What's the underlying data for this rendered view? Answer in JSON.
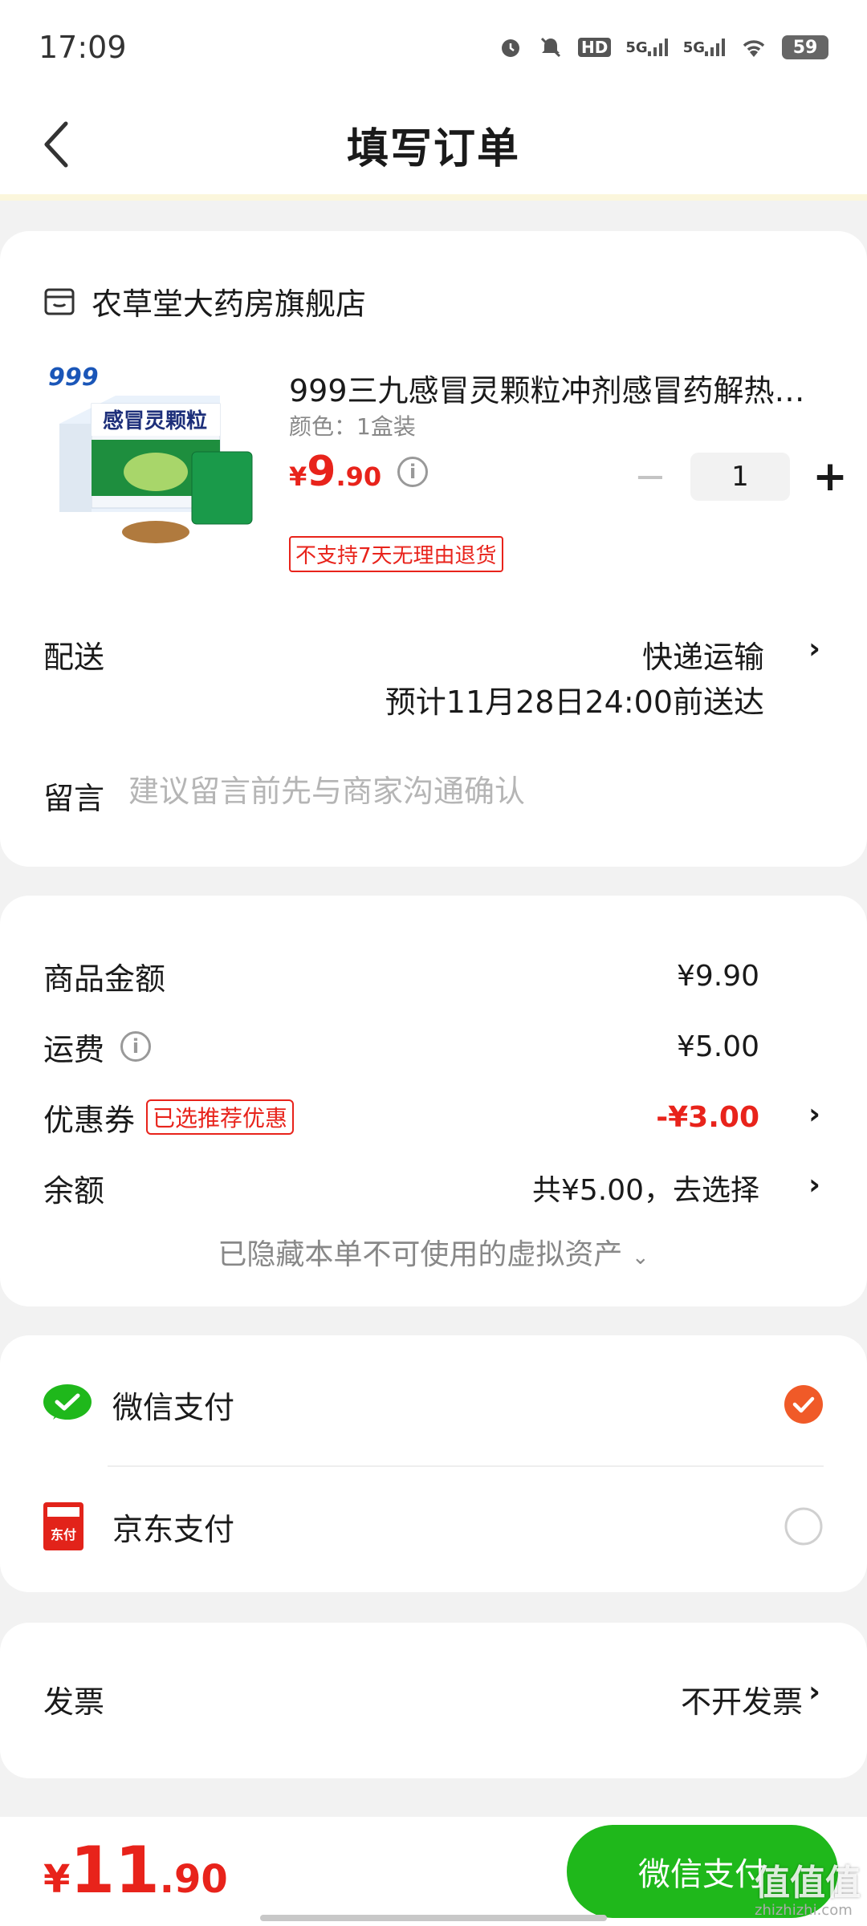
{
  "status_bar": {
    "time": "17:09",
    "icons": [
      "alarm-icon",
      "mute-icon",
      "hd-icon",
      "signal-5g-icon",
      "signal-5g-icon",
      "wifi-icon"
    ],
    "battery": "59",
    "hd_label": "HD",
    "net_label": "5G"
  },
  "header": {
    "title": "填写订单"
  },
  "store": {
    "name": "农草堂大药房旗舰店"
  },
  "product": {
    "title": "999三九感冒灵颗粒冲剂感冒药解热…",
    "spec": "颜色：1盒装",
    "price_symbol": "¥",
    "price_int": "9",
    "price_dec": ".90",
    "quantity": "1",
    "return_tag": "不支持7天无理由退货",
    "box_brand": "999",
    "box_name": "感冒灵颗粒"
  },
  "delivery": {
    "label": "配送",
    "method": "快递运输",
    "estimate": "预计11月28日24:00前送达"
  },
  "message": {
    "label": "留言",
    "placeholder": "建议留言前先与商家沟通确认"
  },
  "amounts": {
    "goods_label": "商品金额",
    "goods_value": "¥9.90",
    "shipping_label": "运费",
    "shipping_value": "¥5.00",
    "coupon_label": "优惠券",
    "coupon_tag": "已选推荐优惠",
    "coupon_value": "-¥3.00",
    "balance_label": "余额",
    "balance_value": "共¥5.00，去选择",
    "hidden_assets": "已隐藏本单不可使用的虚拟资产"
  },
  "payment": {
    "methods": [
      {
        "label": "微信支付",
        "selected": true
      },
      {
        "label": "京东支付",
        "selected": false
      }
    ],
    "jd_icon_text": "东付"
  },
  "invoice": {
    "label": "发票",
    "value": "不开发票"
  },
  "bottom": {
    "total_symbol": "¥",
    "total_int": "11",
    "total_dec": ".90",
    "pay_button": "微信支付",
    "watermark": "值值值",
    "watermark_sub": "zhizhizhi.com"
  },
  "colors": {
    "accent_red": "#e8231b",
    "wechat_green": "#1fb81b",
    "check_orange": "#f05a28"
  }
}
